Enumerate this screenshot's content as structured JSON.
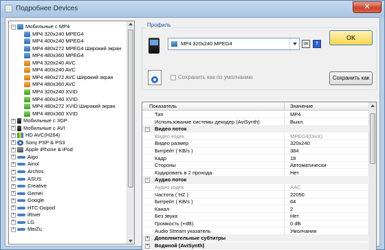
{
  "window": {
    "title": "Подробнее Devices",
    "close_symbol": "✕"
  },
  "tree": {
    "root": "Мобильные с MP4",
    "children": [
      {
        "label": "MP4 320x240 MPEG4",
        "icon": "blue"
      },
      {
        "label": "MP4 400x240 MPEG4",
        "icon": "blue"
      },
      {
        "label": "MP4 480x272 MPEG4 Широкий экран",
        "icon": "blue"
      },
      {
        "label": "MP4 480x360 MPEG4",
        "icon": "blue"
      },
      {
        "label": "MP4 320x240 AVC",
        "icon": "orange"
      },
      {
        "label": "MP4 400x240 AVC",
        "icon": "orange"
      },
      {
        "label": "MP4 480x272 AVC Широкий экран",
        "icon": "orange"
      },
      {
        "label": "MP4 480x360 AVC",
        "icon": "orange"
      },
      {
        "label": "MP4 320x240 XVID",
        "icon": "green"
      },
      {
        "label": "MP4 400x240 XVID",
        "icon": "green"
      },
      {
        "label": "MP4 480x272 XVID Широкий экран",
        "icon": "green"
      },
      {
        "label": "MP4 480x360 XVID",
        "icon": "green"
      }
    ],
    "groups": [
      {
        "label": "Мобильные с 3GP",
        "icon": "phone"
      },
      {
        "label": "Мобильные с AVI",
        "icon": "phone"
      },
      {
        "label": "HD AVC(H264)",
        "icon": "dots"
      },
      {
        "label": "Sony PSP & PS3",
        "icon": "disc"
      },
      {
        "label": "Apple iPhone & iPod",
        "icon": "gray"
      },
      {
        "label": "Aigo",
        "icon": "cable"
      },
      {
        "label": "Ainol",
        "icon": "cable"
      },
      {
        "label": "Archos",
        "icon": "cable"
      },
      {
        "label": "ASUS",
        "icon": "cable"
      },
      {
        "label": "Creative",
        "icon": "cable"
      },
      {
        "label": "Gemei",
        "icon": "cable"
      },
      {
        "label": "Google",
        "icon": "cable"
      },
      {
        "label": "HTC-Dopod",
        "icon": "cable"
      },
      {
        "label": "iRiver",
        "icon": "cable"
      },
      {
        "label": "LG",
        "icon": "cable"
      },
      {
        "label": "MeiZu",
        "icon": "cable"
      }
    ]
  },
  "profile": {
    "group_label": "Профиль",
    "selected": "MP4 320x240 MPEG4",
    "cfg_symbol": "ок",
    "help_symbol": "?",
    "ok_label": "OK",
    "save_default_label": "Сохранить как по умолчанию",
    "save_as_label": "Сохранить как"
  },
  "grid": {
    "col_key": "Показатель",
    "col_value": "Значение",
    "rows": [
      {
        "k": "Тип",
        "v": "MP4",
        "type": "normal"
      },
      {
        "k": "Использование системы декодер (AviSynth)",
        "v": "Выкл.",
        "type": "normal"
      },
      {
        "k": "Видео поток",
        "v": "",
        "type": "section",
        "exp": "−"
      },
      {
        "k": "Видео кодек",
        "v": "MPEG4(DivX)",
        "type": "disabled"
      },
      {
        "k": "Видео размер",
        "v": "320x240",
        "type": "normal"
      },
      {
        "k": "Битрейт ( KB/s )",
        "v": "384",
        "type": "normal"
      },
      {
        "k": "Кадр",
        "v": "18",
        "type": "normal"
      },
      {
        "k": "Стороны",
        "v": "Автоматически",
        "type": "normal"
      },
      {
        "k": "Кодировать в 2 прохода",
        "v": "Нет",
        "type": "normal"
      },
      {
        "k": "Аудио поток",
        "v": "",
        "type": "section",
        "exp": "−"
      },
      {
        "k": "Аудио кодек",
        "v": "AAC",
        "type": "disabled"
      },
      {
        "k": "Частота ( HZ )",
        "v": "22050",
        "type": "normal"
      },
      {
        "k": "Битрейт ( KB/s )",
        "v": "64",
        "type": "normal"
      },
      {
        "k": "Канал",
        "v": "2",
        "type": "normal"
      },
      {
        "k": "Без звука",
        "v": "Нет",
        "type": "normal"
      },
      {
        "k": "Громкость (+dB)",
        "v": "0 dB",
        "type": "normal"
      },
      {
        "k": "Audio Stream указатель",
        "v": "Умолчания",
        "type": "normal"
      },
      {
        "k": "Дополнительные субтитры",
        "v": "",
        "type": "section",
        "exp": "+"
      },
      {
        "k": "Водяной (AviSynth)",
        "v": "",
        "type": "section",
        "exp": "+"
      }
    ]
  }
}
